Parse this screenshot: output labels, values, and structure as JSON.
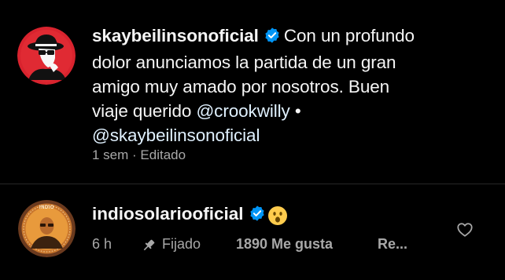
{
  "caption": {
    "username": "skaybeilinsonoficial",
    "lines": [
      "Con un profundo",
      "dolor anunciamos la partida de un gran",
      "amigo muy amado por nosotros. Buen",
      "viaje querido "
    ],
    "mention_1": "@crookwilly",
    "separator": " •",
    "mention_2": "@skaybeilinsonoficial",
    "meta": "1 sem · Editado"
  },
  "comment": {
    "username": "indiosolariooficial",
    "emoji": "😮",
    "time": "6 h",
    "pinned": "Fijado",
    "likes": "1890 Me gusta",
    "reply": "Re..."
  },
  "avatar_2_text": "INDIO",
  "colors": {
    "background": "#000000",
    "verified": "#0095f6",
    "secondary_text": "#a8a8a8",
    "avatar1_bg": "#d9232e",
    "avatar2_ring": "#6b3a1e"
  },
  "icons": [
    "verified-badge-icon",
    "pin-icon",
    "heart-icon",
    "astonished-emoji-icon"
  ]
}
